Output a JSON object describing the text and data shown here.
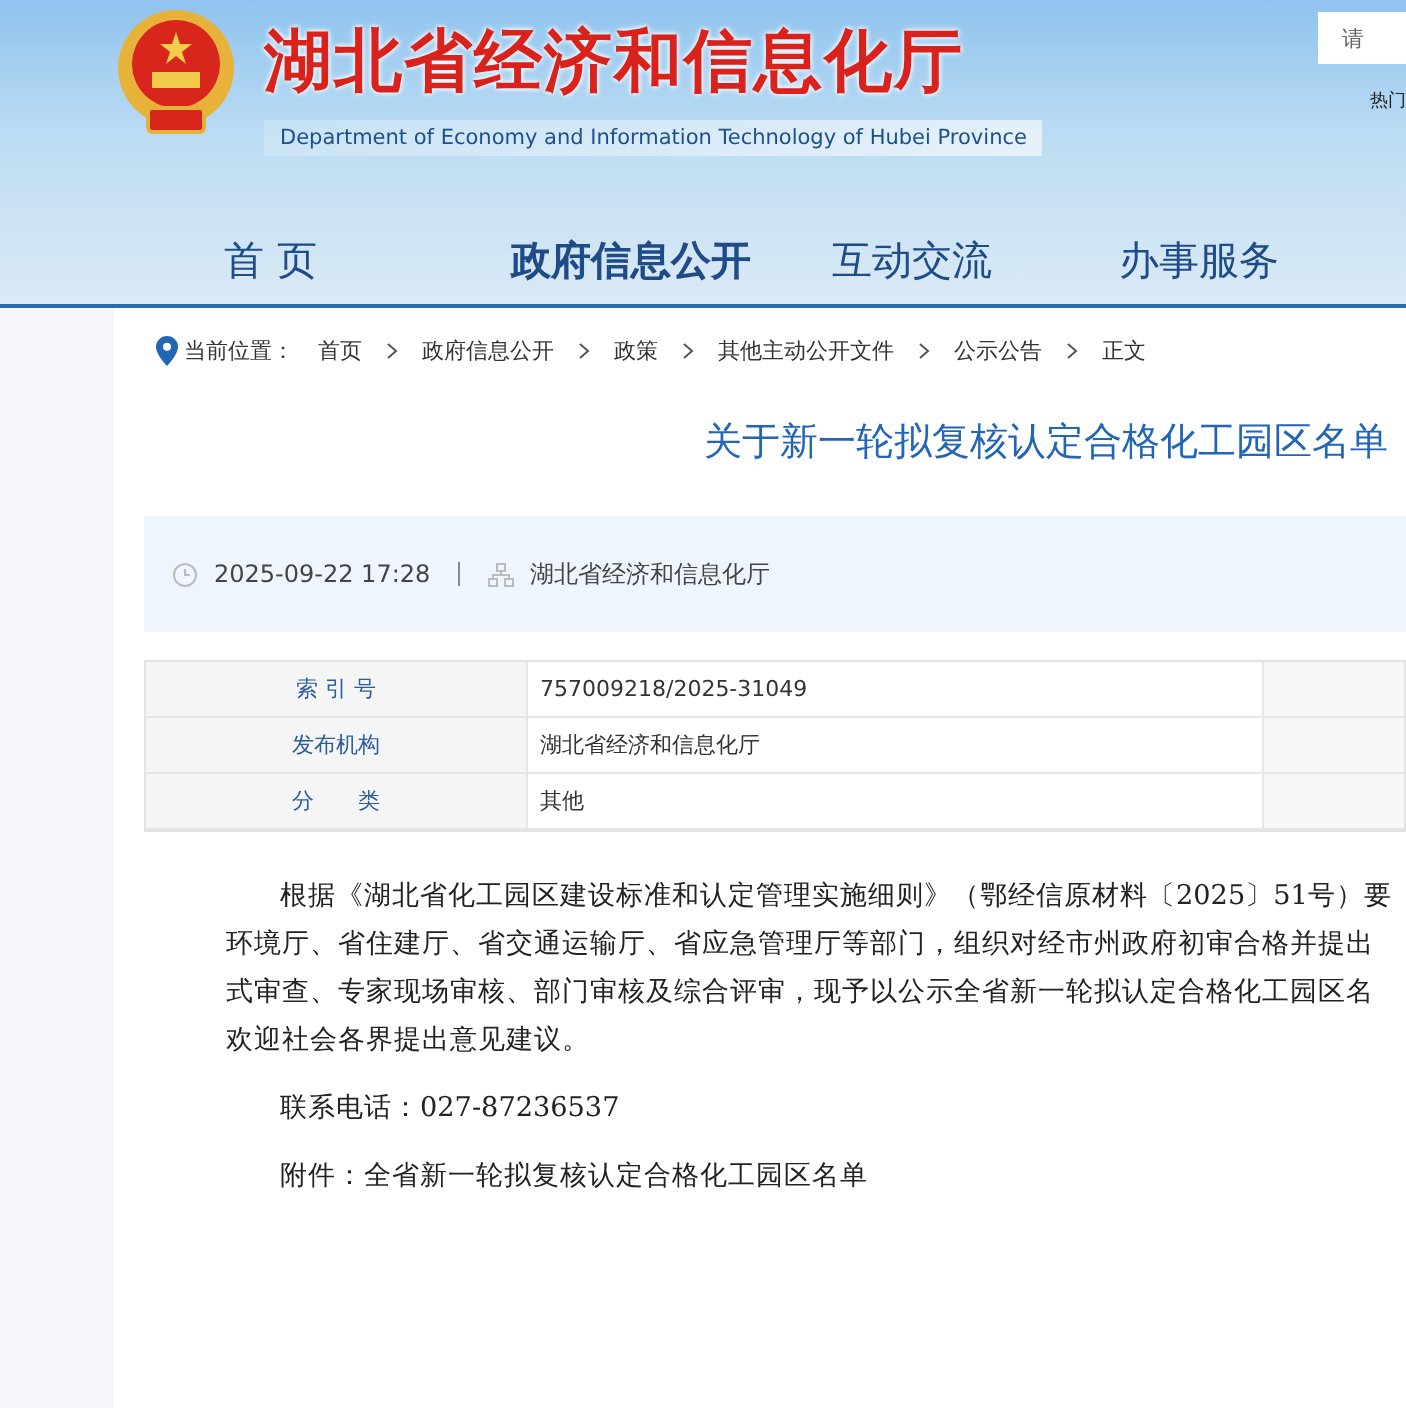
{
  "header": {
    "title": "湖北省经济和信息化厅",
    "subtitle": "Department of Economy and Information Technology of Hubei Province",
    "search": {
      "placeholder": "请"
    },
    "hot_search": "热门"
  },
  "nav": [
    {
      "label": "首 页",
      "selected": false
    },
    {
      "label": "政府信息公开",
      "selected": true
    },
    {
      "label": "互动交流",
      "selected": false
    },
    {
      "label": "办事服务",
      "selected": false
    }
  ],
  "breadcrumb": {
    "label": "当前位置：",
    "items": [
      "首页",
      "政府信息公开",
      "政策",
      "其他主动公开文件",
      "公示公告",
      "正文"
    ]
  },
  "article": {
    "title": "关于新一轮拟复核认定合格化工园区名单",
    "date": "2025-09-22 17:28",
    "source": "湖北省经济和信息化厅"
  },
  "info_table": {
    "rows": [
      {
        "label": "索 引 号",
        "value": "757009218/2025-31049"
      },
      {
        "label": "发布机构",
        "value": "湖北省经济和信息化厅"
      },
      {
        "label": "分　　类",
        "value": "其他"
      }
    ]
  },
  "body": {
    "paragraph_lines": [
      "根据《湖北省化工园区建设标准和认定管理实施细则》（鄂经信原材料〔2025〕51号）要",
      "环境厅、省住建厅、省交通运输厅、省应急管理厅等部门，组织对经市州政府初审合格并提出",
      "式审查、专家现场审核、部门审核及综合评审，现予以公示全省新一轮拟认定合格化工园区名",
      "欢迎社会各界提出意见建议。"
    ],
    "contact": "联系电话：027-87236537",
    "attachment": "附件：全省新一轮拟复核认定合格化工园区名单"
  }
}
